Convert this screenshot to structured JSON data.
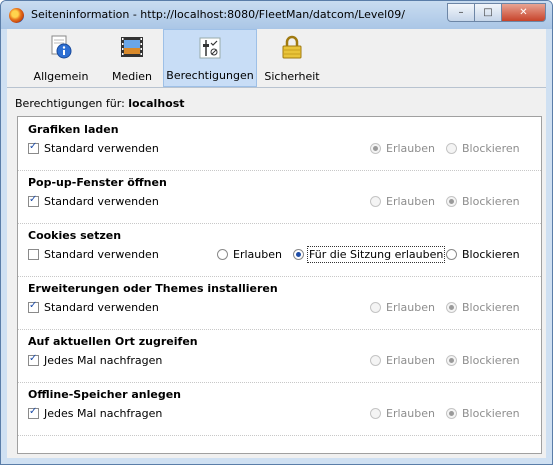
{
  "window": {
    "title": "Seiteninformation - http://localhost:8080/FleetMan/datcom/Level09/",
    "minimize_glyph": "–",
    "maximize_glyph": "□",
    "close_glyph": "✕"
  },
  "toolbar": {
    "tabs": [
      {
        "label": "Allgemein",
        "icon": "info-icon"
      },
      {
        "label": "Medien",
        "icon": "media-icon"
      },
      {
        "label": "Berechtigungen",
        "icon": "permissions-icon",
        "active": true
      },
      {
        "label": "Sicherheit",
        "icon": "lock-icon"
      }
    ]
  },
  "permissions": {
    "for_label": "Berechtigungen für:",
    "host": "localhost",
    "sections": [
      {
        "title": "Grafiken laden",
        "checkbox_label": "Standard verwenden",
        "checked": true,
        "options": [
          "Erlauben",
          "Blockieren"
        ],
        "selected": "Erlauben",
        "enabled": false
      },
      {
        "title": "Pop-up-Fenster öffnen",
        "checkbox_label": "Standard verwenden",
        "checked": true,
        "options": [
          "Erlauben",
          "Blockieren"
        ],
        "selected": "Blockieren",
        "enabled": false
      },
      {
        "title": "Cookies setzen",
        "checkbox_label": "Standard verwenden",
        "checked": false,
        "options": [
          "Erlauben",
          "Für die Sitzung erlauben",
          "Blockieren"
        ],
        "selected": "Für die Sitzung erlauben",
        "enabled": true
      },
      {
        "title": "Erweiterungen oder Themes installieren",
        "checkbox_label": "Standard verwenden",
        "checked": true,
        "options": [
          "Erlauben",
          "Blockieren"
        ],
        "selected": "Blockieren",
        "enabled": false
      },
      {
        "title": "Auf aktuellen Ort zugreifen",
        "checkbox_label": "Jedes Mal nachfragen",
        "checked": true,
        "options": [
          "Erlauben",
          "Blockieren"
        ],
        "selected": "Blockieren",
        "enabled": false
      },
      {
        "title": "Offline-Speicher anlegen",
        "checkbox_label": "Jedes Mal nachfragen",
        "checked": true,
        "options": [
          "Erlauben",
          "Blockieren"
        ],
        "selected": "Blockieren",
        "enabled": false
      }
    ]
  }
}
